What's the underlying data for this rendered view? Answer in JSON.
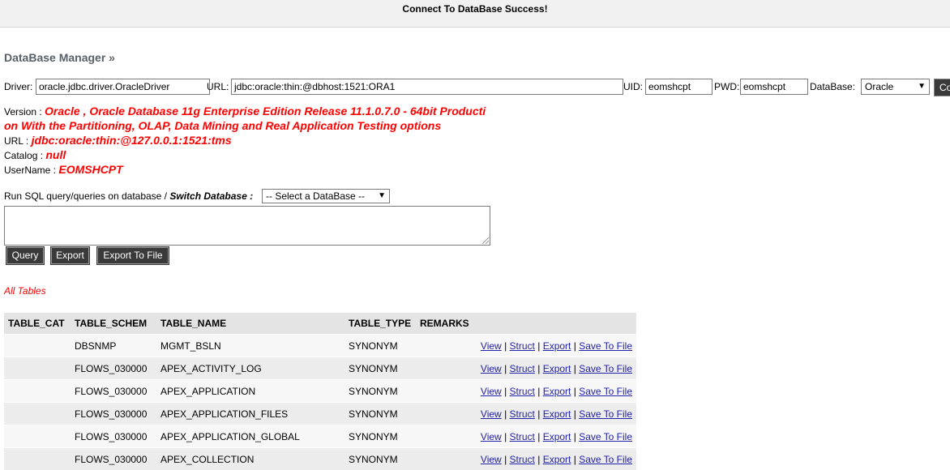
{
  "banner": "Connect To DataBase Success!",
  "title": "DataBase Manager",
  "title_suffix": "»",
  "connection": {
    "driver_label": "Driver:",
    "driver_value": "oracle.jdbc.driver.OracleDriver",
    "url_label": "URL:",
    "url_value": "jdbc:oracle:thin:@dbhost:1521:ORA1",
    "uid_label": "UID:",
    "uid_value": "eomshcpt",
    "pwd_label": "PWD:",
    "pwd_value": "eomshcpt",
    "db_label": "DataBase:",
    "db_selected": "Oracle",
    "connect_button": "Co"
  },
  "info": {
    "version_label": "Version :",
    "version_value_1": "Oracle , Oracle Database 11g Enterprise Edition Release 11.1.0.7.0 - 64bit Producti",
    "version_value_2": "on With the Partitioning, OLAP, Data Mining and Real Application Testing options",
    "url_label": "URL :",
    "url_value": "jdbc:oracle:thin:@127.0.0.1:1521:tms",
    "catalog_label": "Catalog :",
    "catalog_value": "null",
    "username_label": "UserName :",
    "username_value": "EOMSHCPT"
  },
  "sql": {
    "prompt": "Run SQL query/queries on database /",
    "switch_label": "Switch Database :",
    "switch_selected": "-- Select a DataBase --",
    "query_text": "",
    "query_button": "Query",
    "export_button": "Export",
    "export_file_button": "Export To File"
  },
  "all_tables_label": "All Tables",
  "table": {
    "headers": [
      "TABLE_CAT",
      "TABLE_SCHEM",
      "TABLE_NAME",
      "TABLE_TYPE",
      "REMARKS"
    ],
    "actions": {
      "view": "View",
      "struct": "Struct",
      "export": "Export",
      "save": "Save To File",
      "sep": "|"
    },
    "rows": [
      {
        "cat": "",
        "schem": "DBSNMP",
        "name": "MGMT_BSLN",
        "type": "SYNONYM",
        "remarks": ""
      },
      {
        "cat": "",
        "schem": "FLOWS_030000",
        "name": "APEX_ACTIVITY_LOG",
        "type": "SYNONYM",
        "remarks": ""
      },
      {
        "cat": "",
        "schem": "FLOWS_030000",
        "name": "APEX_APPLICATION",
        "type": "SYNONYM",
        "remarks": ""
      },
      {
        "cat": "",
        "schem": "FLOWS_030000",
        "name": "APEX_APPLICATION_FILES",
        "type": "SYNONYM",
        "remarks": ""
      },
      {
        "cat": "",
        "schem": "FLOWS_030000",
        "name": "APEX_APPLICATION_GLOBAL",
        "type": "SYNONYM",
        "remarks": ""
      },
      {
        "cat": "",
        "schem": "FLOWS_030000",
        "name": "APEX_COLLECTION",
        "type": "SYNONYM",
        "remarks": ""
      }
    ]
  }
}
